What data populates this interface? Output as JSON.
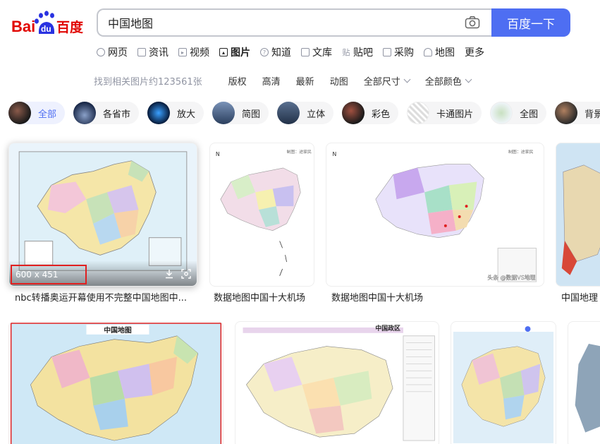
{
  "logo": {
    "text_left": "Bai",
    "text_paw": "du",
    "text_right": "百度"
  },
  "search": {
    "query": "中国地图",
    "button_label": "百度一下"
  },
  "tabs": [
    {
      "label": "网页",
      "icon": "search-icon"
    },
    {
      "label": "资讯",
      "icon": "news-icon"
    },
    {
      "label": "视频",
      "icon": "video-icon"
    },
    {
      "label": "图片",
      "icon": "image-icon",
      "active": true
    },
    {
      "label": "知道",
      "icon": "question-icon"
    },
    {
      "label": "文库",
      "icon": "doc-icon"
    },
    {
      "label": "贴吧",
      "icon": "tieba-icon"
    },
    {
      "label": "采购",
      "icon": "shopping-icon"
    },
    {
      "label": "地图",
      "icon": "map-icon"
    },
    {
      "label": "更多",
      "icon": ""
    }
  ],
  "filters": {
    "result_count": "找到相关图片约123561张",
    "items": [
      "版权",
      "高清",
      "最新",
      "动图",
      "全部尺寸",
      "全部颜色"
    ]
  },
  "chips": [
    "全部",
    "各省市",
    "放大",
    "简图",
    "立体",
    "彩色",
    "卡通图片",
    "全图",
    "背景"
  ],
  "images": {
    "hover_size": "600 x 451",
    "captions": [
      "nbc转播奥运开幕使用不完整中国地图中...",
      "数据地图中国十大机场",
      "数据地图中国十大机场",
      "中国地理"
    ],
    "titles": [
      "中国地图",
      "中国政区"
    ],
    "watermark": "头条 @数据VS地理"
  },
  "colors": {
    "accent": "#4e6ef2",
    "logo_red": "#e10602",
    "logo_blue": "#2932e1"
  }
}
